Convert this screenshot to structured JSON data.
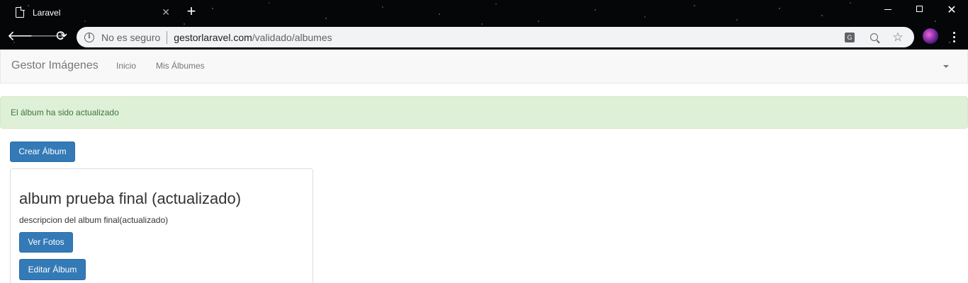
{
  "browser": {
    "tab_title": "Laravel",
    "tab_close": "✕",
    "new_tab": "+",
    "security_label": "No es seguro",
    "url_host": "gestorlaravel.com",
    "url_path": "/validado/albumes",
    "back_glyph": "🡐",
    "forward_glyph": "🡒",
    "reload_glyph": "⟳",
    "close_glyph": "✕",
    "star_glyph": "☆",
    "translate_glyph": "G",
    "info_glyph": "i"
  },
  "navbar": {
    "brand": "Gestor Imágenes",
    "links": [
      "Inicio",
      "Mis Álbumes"
    ]
  },
  "alert": {
    "message": "El álbum ha sido actualizado"
  },
  "actions": {
    "create_album": "Crear Álbum"
  },
  "album": {
    "title": "album prueba final (actualizado)",
    "description": "descripcion del album final(actualizado)",
    "view_photos": "Ver Fotos",
    "edit_album": "Editar Álbum"
  },
  "colors": {
    "primary": "#337ab7",
    "success_bg": "#dff0d8",
    "success_text": "#3c763d",
    "navbar_bg": "#f8f8f8"
  }
}
